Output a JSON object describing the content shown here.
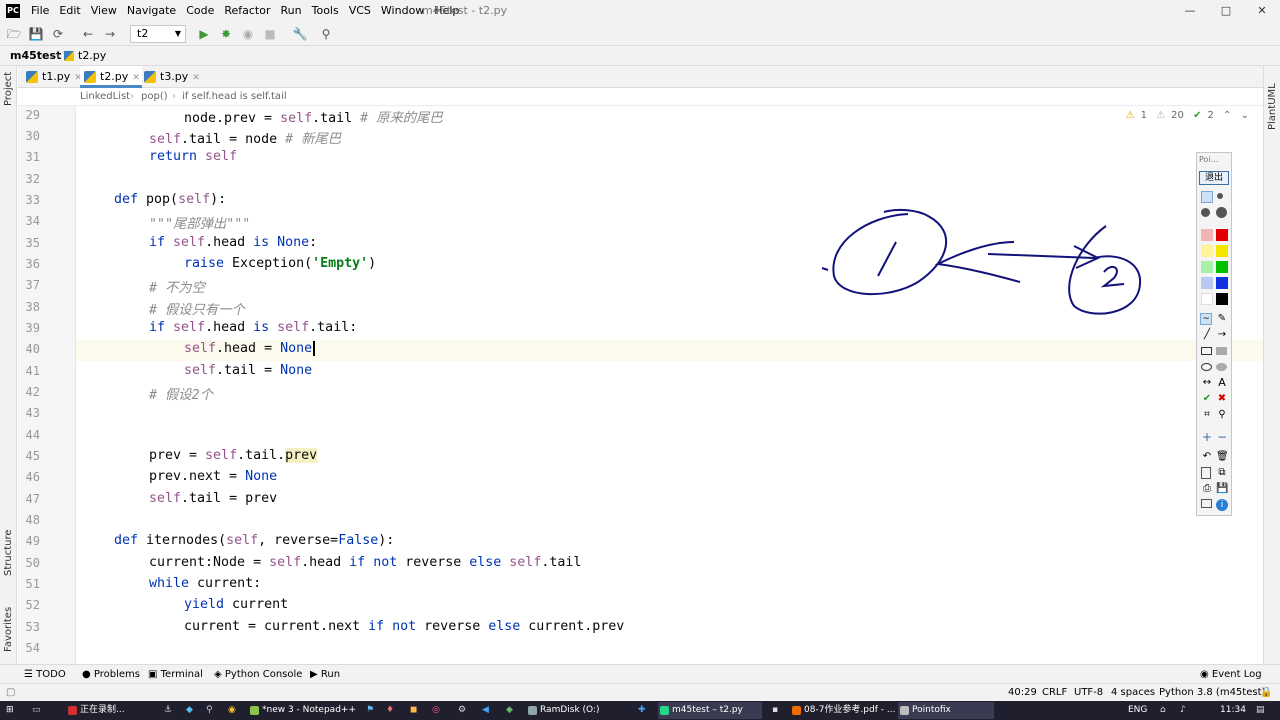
{
  "window": {
    "title": "m45test - t2.py",
    "app_icon": "PC",
    "minimize": "—",
    "maximize": "□",
    "close": "✕"
  },
  "menu": [
    "File",
    "Edit",
    "View",
    "Navigate",
    "Code",
    "Refactor",
    "Run",
    "Tools",
    "VCS",
    "Window",
    "Help"
  ],
  "toolbar": {
    "run_config": "t2"
  },
  "navbar": {
    "project": "m45test",
    "file": "t2.py"
  },
  "left_strip": {
    "project": "Project",
    "structure": "Structure",
    "favorites": "Favorites"
  },
  "right_strip": {
    "plantuml": "PlantUML"
  },
  "tabs": [
    {
      "label": "t1.py",
      "active": false
    },
    {
      "label": "t2.py",
      "active": true
    },
    {
      "label": "t3.py",
      "active": false
    }
  ],
  "breadcrumbs": [
    "LinkedList",
    "pop()",
    "if self.head is self.tail"
  ],
  "inspections": {
    "warnings": "1",
    "weak_warnings": "20",
    "typos": "2"
  },
  "lines": {
    "n29": "29",
    "n30": "30",
    "n31": "31",
    "n32": "32",
    "n33": "33",
    "n34": "34",
    "n35": "35",
    "n36": "36",
    "n37": "37",
    "n38": "38",
    "n39": "39",
    "n40": "40",
    "n41": "41",
    "n42": "42",
    "n43": "43",
    "n44": "44",
    "n45": "45",
    "n46": "46",
    "n47": "47",
    "n48": "48",
    "n49": "49",
    "n50": "50",
    "n51": "51",
    "n52": "52",
    "n53": "53",
    "n54": "54"
  },
  "code": {
    "l29a": "node.prev = ",
    "l29b": "self",
    "l29c": ".tail ",
    "l29d": "# 原来的尾巴",
    "l30a": "self",
    "l30b": ".tail = node ",
    "l30c": "# 新尾巴",
    "l31a": "return ",
    "l31b": "self",
    "l33a": "def ",
    "l33b": "pop(",
    "l33c": "self",
    "l33d": "):",
    "l34": "\"\"\"尾部弹出\"\"\"",
    "l35a": "if ",
    "l35b": "self",
    "l35c": ".head ",
    "l35d": "is ",
    "l35e": "None",
    "l35f": ":",
    "l36a": "raise ",
    "l36b": "Exception(",
    "l36c": "'Empty'",
    "l36d": ")",
    "l37": "# 不为空",
    "l38": "# 假设只有一个",
    "l39a": "if ",
    "l39b": "self",
    "l39c": ".head ",
    "l39d": "is ",
    "l39e": "self",
    "l39f": ".tail:",
    "l40a": "self",
    "l40b": ".head = ",
    "l40c": "None",
    "l41a": "self",
    "l41b": ".tail = ",
    "l41c": "None",
    "l42": "# 假设2个",
    "l45a": "prev = ",
    "l45b": "self",
    "l45c": ".tail.",
    "l45d": "prev",
    "l46a": "prev.next = ",
    "l46b": "None",
    "l47a": "self",
    "l47b": ".tail = prev",
    "l49a": "def ",
    "l49b": "iternodes(",
    "l49c": "self",
    "l49d": ", reverse=",
    "l49e": "False",
    "l49f": "):",
    "l50a": "current:Node = ",
    "l50b": "self",
    "l50c": ".head ",
    "l50d": "if not ",
    "l50e": "reverse ",
    "l50f": "else ",
    "l50g": "self",
    "l50h": ".tail",
    "l51a": "while ",
    "l51b": "current:",
    "l52a": "yield ",
    "l52b": "current",
    "l53a": "current = current.next ",
    "l53b": "if not ",
    "l53c": "reverse ",
    "l53d": "else ",
    "l53e": "current.prev"
  },
  "pointofix": {
    "title": "Poi...",
    "exit": "退出",
    "text_tool": "A"
  },
  "drawing_labels": {
    "left_node": "1",
    "right_node": "2"
  },
  "bottom_tools": [
    "TODO",
    "Problems",
    "Terminal",
    "Python Console",
    "Run"
  ],
  "event_log": "Event Log",
  "status": {
    "position": "40:29",
    "line_sep": "CRLF",
    "encoding": "UTF-8",
    "indent": "4 spaces",
    "interpreter": "Python 3.8 (m45test)"
  },
  "taskbar": {
    "items": [
      "正在录制...",
      "*new 3 - Notepad++",
      "RamDisk (O:)",
      "m45test – t2.py",
      "08-7作业参考.pdf - ...",
      "Pointofix"
    ],
    "ime": "ENG",
    "time": "11:34"
  }
}
